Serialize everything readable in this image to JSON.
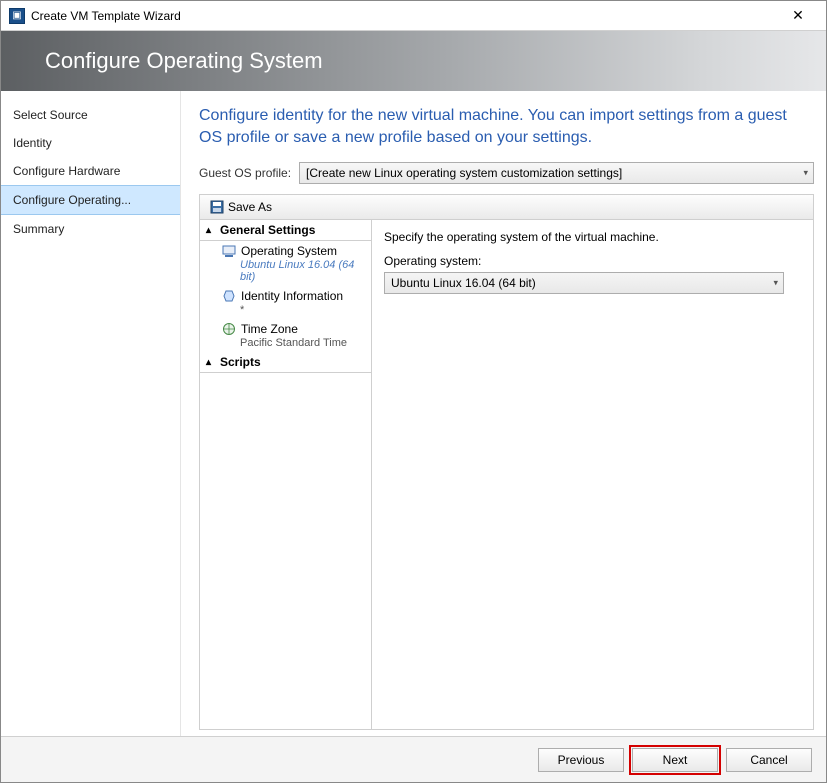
{
  "window": {
    "title": "Create VM Template Wizard"
  },
  "header": {
    "title": "Configure Operating System"
  },
  "sidebar": {
    "steps": [
      {
        "label": "Select Source"
      },
      {
        "label": "Identity"
      },
      {
        "label": "Configure Hardware"
      },
      {
        "label": "Configure Operating..."
      },
      {
        "label": "Summary"
      }
    ],
    "activeIndex": 3
  },
  "content": {
    "instruction": "Configure identity for the new virtual machine. You can import settings from a guest OS profile or save a new profile based on your settings.",
    "profileLabel": "Guest OS profile:",
    "profileValue": "[Create new Linux operating system customization settings]",
    "toolbar": {
      "saveAs": "Save As"
    },
    "treeGroups": {
      "general": "General Settings",
      "scripts": "Scripts"
    },
    "treeNodes": {
      "os": {
        "label": "Operating System",
        "value": "Ubuntu Linux 16.04 (64 bit)"
      },
      "identity": {
        "label": "Identity Information",
        "value": "*"
      },
      "timezone": {
        "label": "Time Zone",
        "value": "Pacific Standard Time"
      }
    },
    "detail": {
      "title": "Specify the operating system of the virtual machine.",
      "label": "Operating system:",
      "value": "Ubuntu Linux 16.04 (64 bit)"
    }
  },
  "footer": {
    "previous": "Previous",
    "next": "Next",
    "cancel": "Cancel"
  },
  "icons": {
    "saveAs": "save-icon",
    "os": "os-icon",
    "identity": "identity-icon",
    "timezone": "timezone-icon"
  }
}
